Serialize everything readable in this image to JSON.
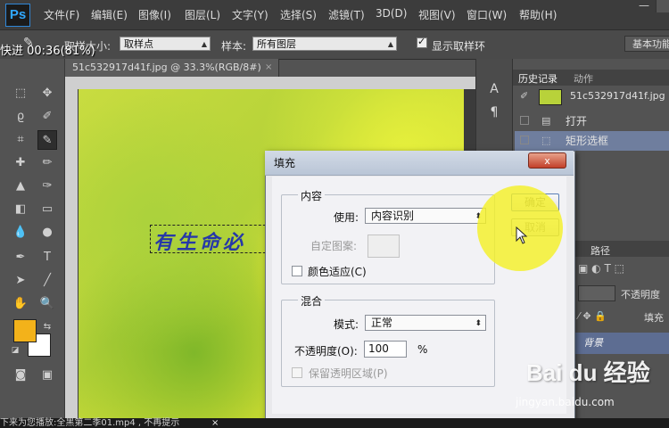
{
  "app": {
    "logo": "Ps",
    "menu": [
      "文件(F)",
      "编辑(E)",
      "图像(I)",
      "图层(L)",
      "文字(Y)",
      "选择(S)",
      "滤镜(T)",
      "3D(D)",
      "视图(V)",
      "窗口(W)",
      "帮助(H)"
    ],
    "window_minimize": "—"
  },
  "options_bar": {
    "sample_size_label": "取样大小:",
    "sample_size_value": "取样点",
    "sample_label": "样本:",
    "sample_value": "所有图层",
    "show_ring_label": "显示取样环",
    "workspace_label": "基本功能"
  },
  "document": {
    "tab_title": "51c532917d41f.jpg @ 33.3%(RGB/8#)",
    "tab_close": "×",
    "canvas_text": "有生命必"
  },
  "history_panel": {
    "tabs": [
      "历史记录",
      "动作"
    ],
    "snapshot_name": "51c532917d41f.jpg",
    "items": [
      {
        "label": "打开"
      },
      {
        "label": "矩形选框"
      }
    ]
  },
  "layers_panel": {
    "tab_paths": "路径",
    "opacity_label": "不透明度",
    "fill_label": "填充",
    "layer_name": "背景"
  },
  "dialog": {
    "title": "填充",
    "close_label": "x",
    "content_group": "内容",
    "use_label": "使用:",
    "use_value": "内容识别",
    "pattern_label": "自定图案:",
    "color_adapt_label": "颜色适应(C)",
    "blend_group": "混合",
    "mode_label": "模式:",
    "mode_value": "正常",
    "opacity_label": "不透明度(O):",
    "opacity_value": "100",
    "opacity_unit": "%",
    "preserve_label": "保留透明区域(P)",
    "ok_label": "确定",
    "cancel_label": "取消"
  },
  "overlay": {
    "progress_text": "快进   00:36(81%)",
    "bottom_text": "下来为您播放:全黑第二季01.mp4 , 不再提示",
    "bottom_close": "×",
    "watermark": "Bai du 经验",
    "watermark_url": "jingyan.baidu.com"
  },
  "colors": {
    "foreground": "#f3b21a",
    "background": "#ffffff",
    "highlight": "#f4f028",
    "selection_row": "#6f7e9e"
  }
}
